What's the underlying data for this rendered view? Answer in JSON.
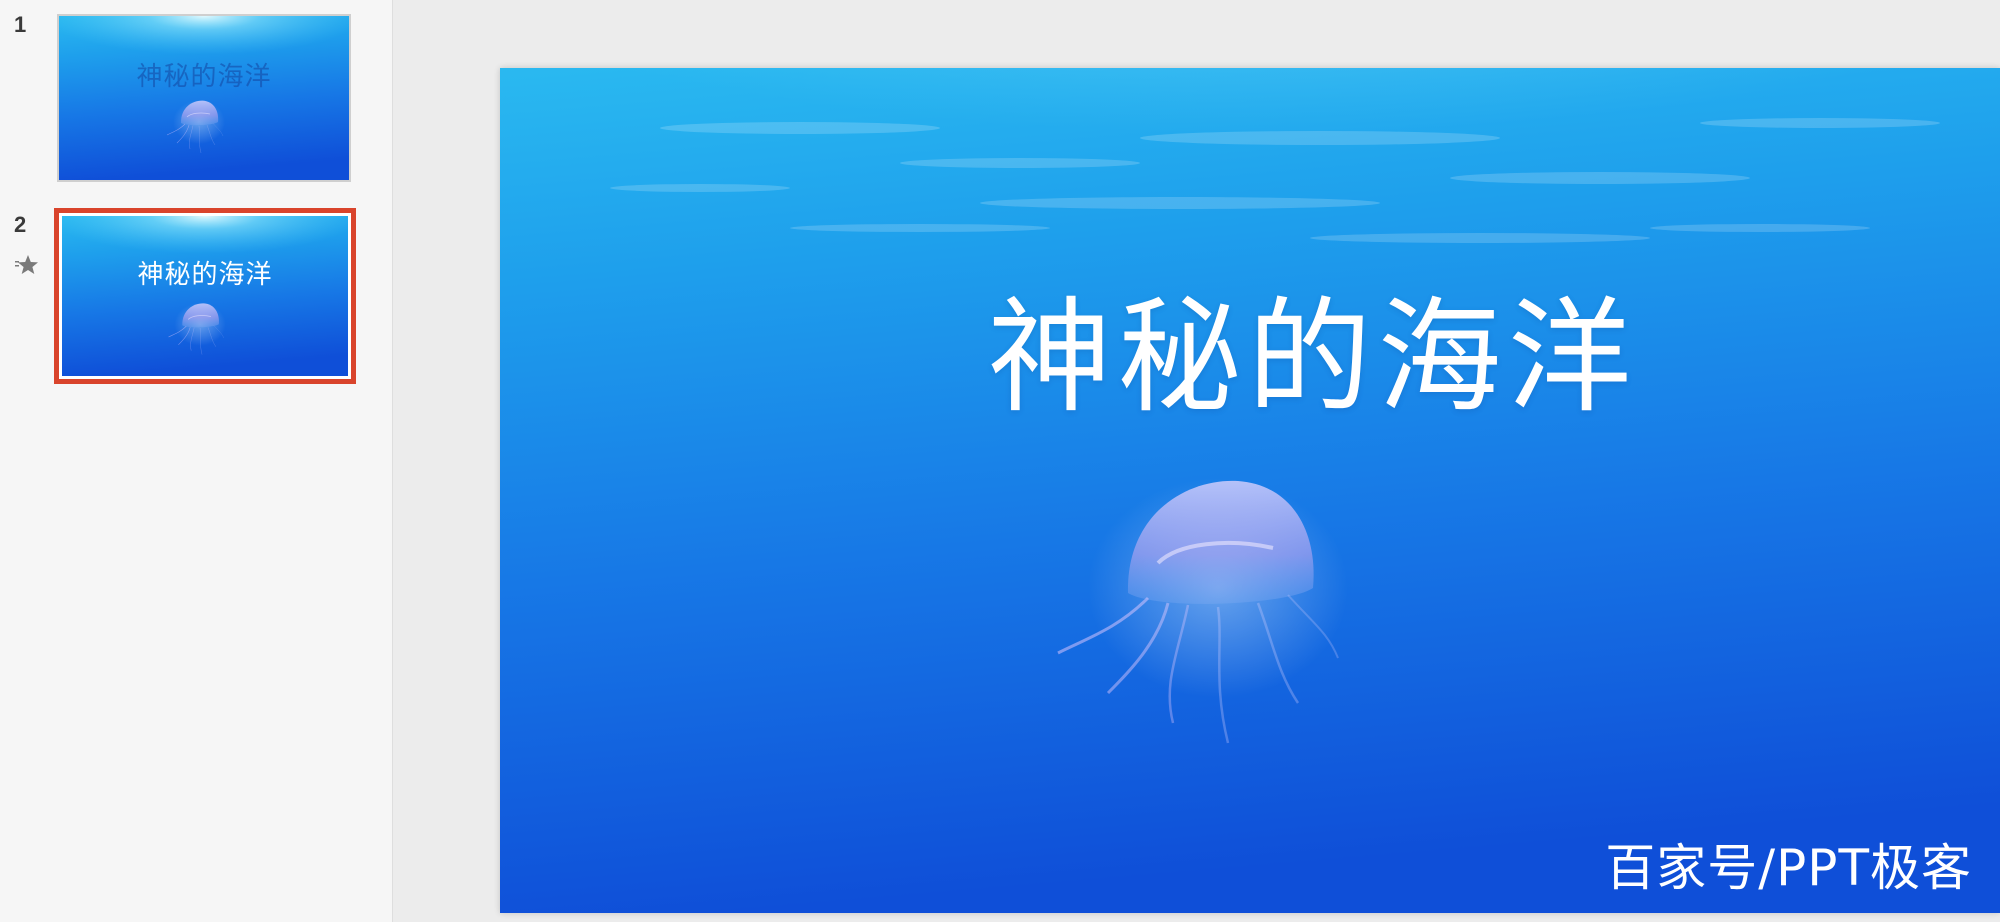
{
  "sidebar": {
    "slides": [
      {
        "number": "1",
        "title": "神秘的海洋"
      },
      {
        "number": "2",
        "title": "神秘的海洋",
        "selected": true,
        "has_animation": true
      }
    ],
    "selection_color": "#d9442c"
  },
  "slide": {
    "title": "神秘的海洋",
    "watermark": "百家号/PPT极客",
    "colors": {
      "ocean_top": "#29b8f0",
      "ocean_bottom": "#1150d8",
      "text": "#ffffff"
    }
  },
  "icons": {
    "animation": "star-icon"
  }
}
